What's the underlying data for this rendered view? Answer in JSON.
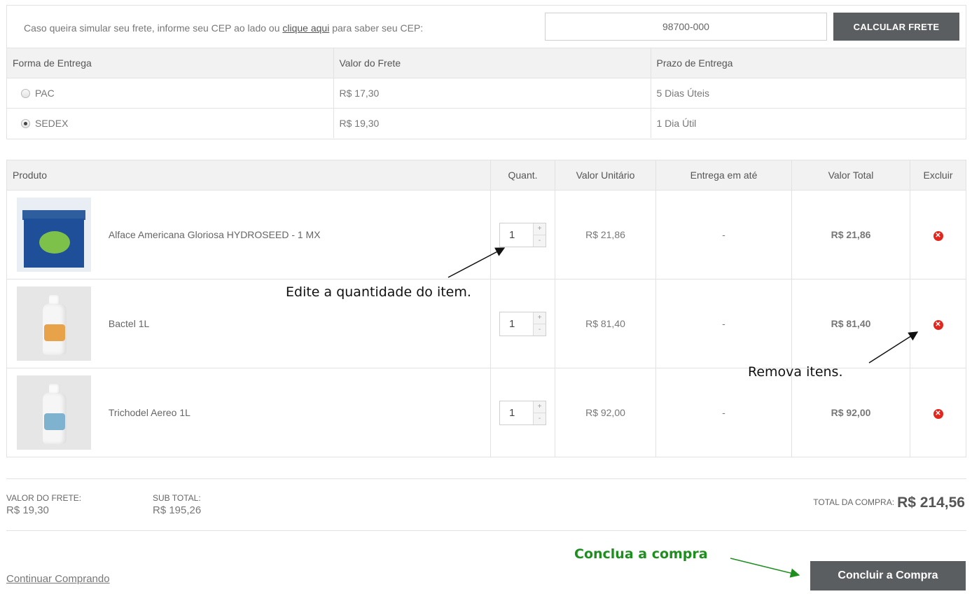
{
  "shipping": {
    "prompt_before": "Caso queira simular seu frete, informe seu CEP ao lado ou ",
    "prompt_link": "clique aqui",
    "prompt_after": " para saber seu CEP:",
    "cep_value": "98700-000",
    "calc_button": "CALCULAR FRETE",
    "headers": [
      "Forma de Entrega",
      "Valor do Frete",
      "Prazo de Entrega"
    ],
    "options": [
      {
        "method": "PAC",
        "price": "R$ 17,30",
        "deadline": "5 Dias Úteis",
        "selected": false
      },
      {
        "method": "SEDEX",
        "price": "R$ 19,30",
        "deadline": "1 Dia Útil",
        "selected": true
      }
    ]
  },
  "cart": {
    "headers": {
      "product": "Produto",
      "qty": "Quant.",
      "unit": "Valor Unitário",
      "delivery": "Entrega em até",
      "total": "Valor Total",
      "remove": "Excluir"
    },
    "qty_plus": "+",
    "qty_minus": "-",
    "remove_icon": "✕",
    "items": [
      {
        "name": "Alface Americana Gloriosa HYDROSEED - 1 MX",
        "qty": "1",
        "unit": "R$ 21,86",
        "delivery": "-",
        "total": "R$ 21,86",
        "image": "seed-packet-image"
      },
      {
        "name": "Bactel 1L",
        "qty": "1",
        "unit": "R$ 81,40",
        "delivery": "-",
        "total": "R$ 81,40",
        "image": "bottle-image"
      },
      {
        "name": "Trichodel Aereo 1L",
        "qty": "1",
        "unit": "R$ 92,00",
        "delivery": "-",
        "total": "R$ 92,00",
        "image": "bottle-image"
      }
    ]
  },
  "summary": {
    "freight_label": "VALOR DO FRETE:",
    "freight_value": "R$ 19,30",
    "subtotal_label": "SUB TOTAL:",
    "subtotal_value": "R$ 195,26",
    "total_label": "TOTAL DA COMPRA:",
    "total_value": "R$ 214,56"
  },
  "footer": {
    "continue_link": "Continuar Comprando",
    "finish_button": "Concluir a Compra"
  },
  "annotations": {
    "edit_qty": "Edite a quantidade do item.",
    "remove_items": "Remova itens.",
    "finish": "Conclua a compra"
  },
  "colors": {
    "button_bg": "#5b5e60",
    "remove_red": "#e2261d",
    "annotation_green": "#1e8f1e"
  }
}
